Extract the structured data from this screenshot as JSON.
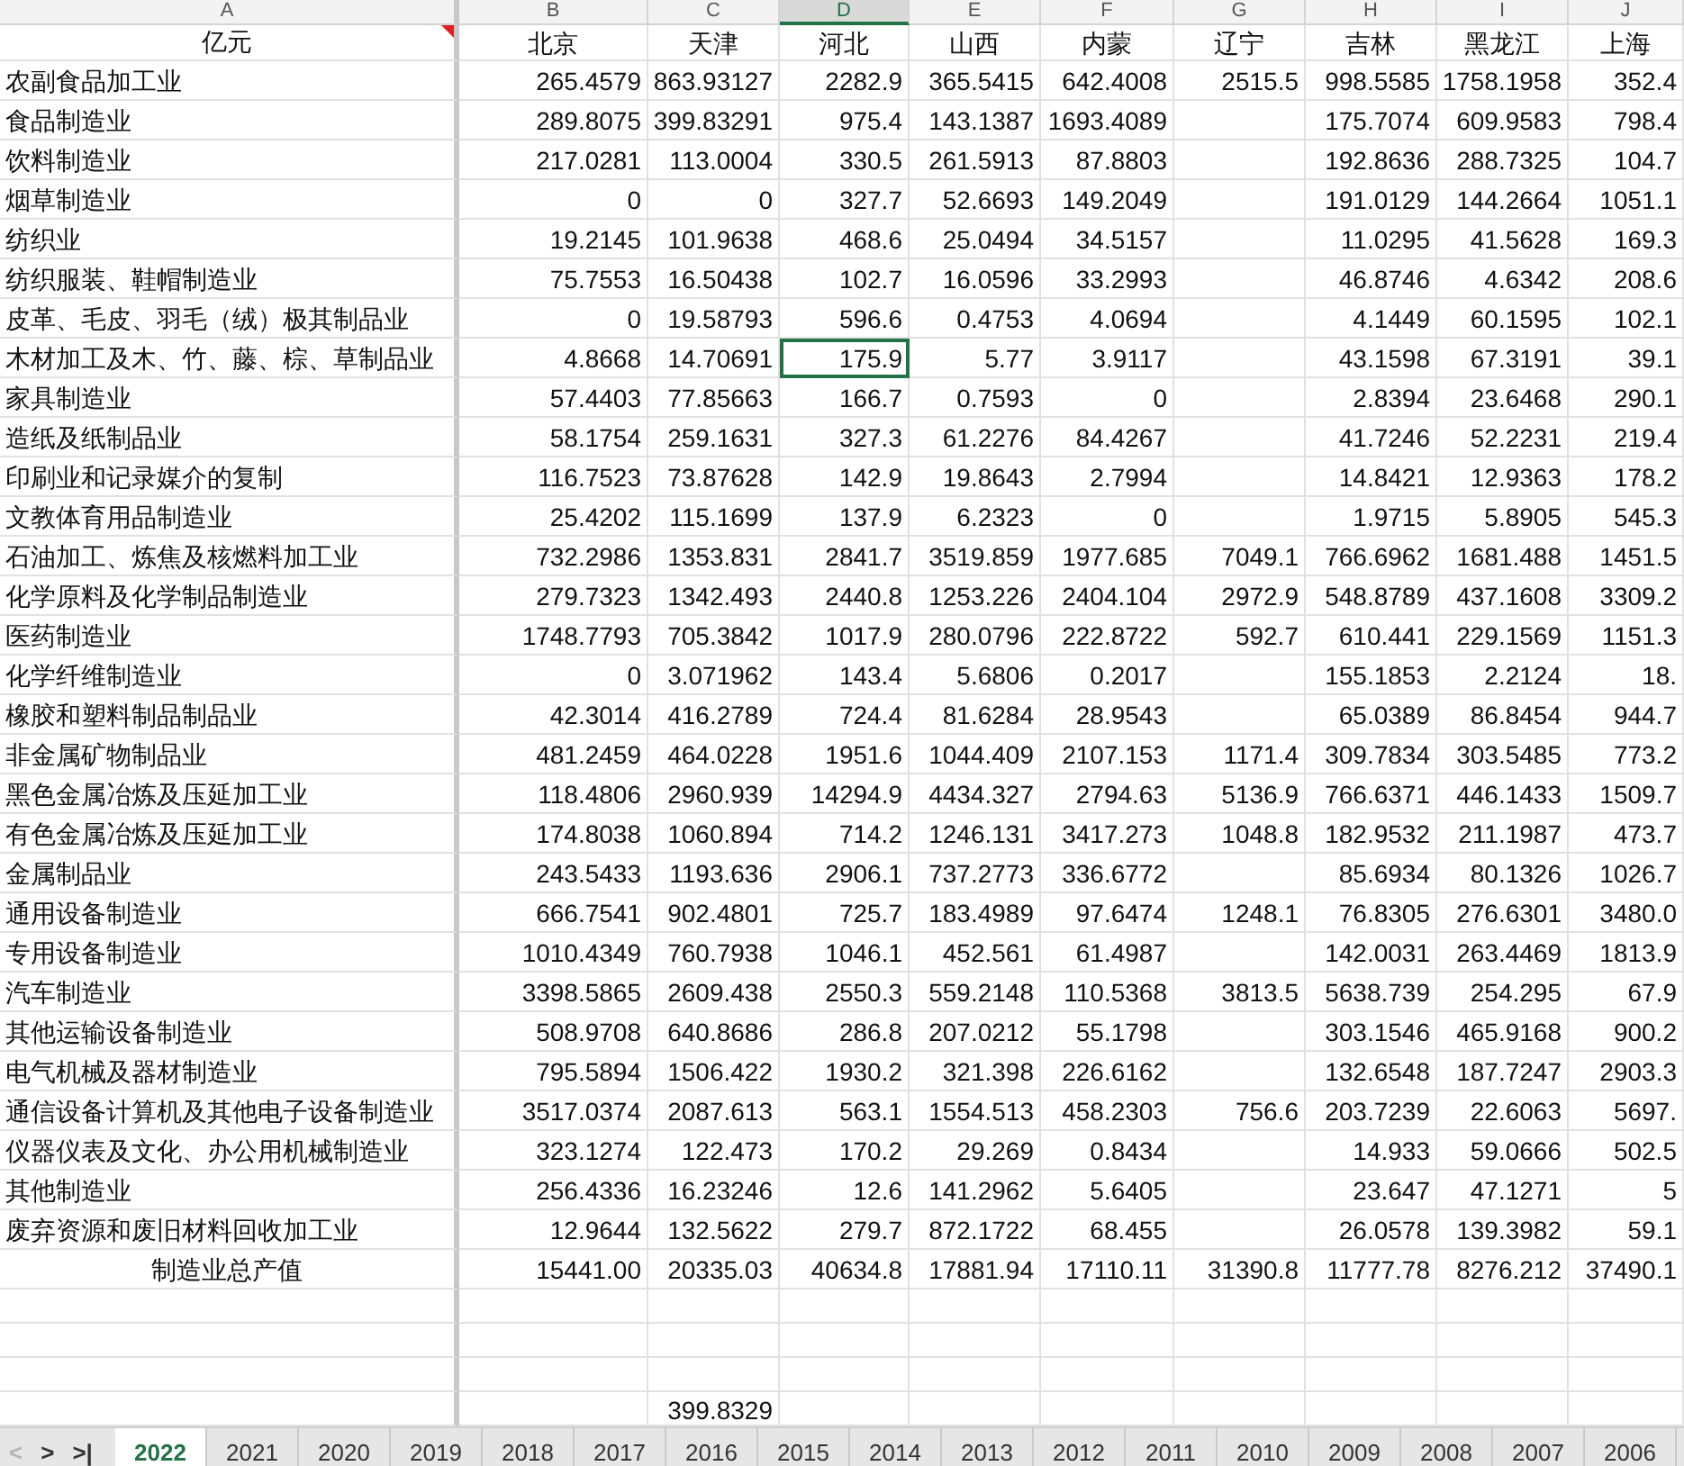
{
  "columns": [
    {
      "letter": "A",
      "selected": false
    },
    {
      "letter": "B",
      "selected": false
    },
    {
      "letter": "C",
      "selected": false
    },
    {
      "letter": "D",
      "selected": true
    },
    {
      "letter": "E",
      "selected": false
    },
    {
      "letter": "F",
      "selected": false
    },
    {
      "letter": "G",
      "selected": false
    },
    {
      "letter": "H",
      "selected": false
    },
    {
      "letter": "I",
      "selected": false
    },
    {
      "letter": "J",
      "selected": false
    }
  ],
  "rows": [
    {
      "kind": "header",
      "label": "亿元",
      "comment": true,
      "selected": false,
      "cells": [
        "北京",
        "天津",
        "河北",
        "山西",
        "内蒙",
        "辽宁",
        "吉林",
        "黑龙江",
        "上海"
      ]
    },
    {
      "kind": "data",
      "label": "农副食品加工业",
      "comment": false,
      "selected": false,
      "cells": [
        "265.4579",
        "863.93127",
        "2282.9",
        "365.5415",
        "642.4008",
        "2515.5",
        "998.5585",
        "1758.1958",
        "352.4"
      ]
    },
    {
      "kind": "data",
      "label": "食品制造业",
      "comment": false,
      "selected": false,
      "cells": [
        "289.8075",
        "399.83291",
        "975.4",
        "143.1387",
        "1693.4089",
        null,
        "175.7074",
        "609.9583",
        "798.4"
      ]
    },
    {
      "kind": "data",
      "label": "饮料制造业",
      "comment": false,
      "selected": false,
      "cells": [
        "217.0281",
        "113.0004",
        "330.5",
        "261.5913",
        "87.8803",
        null,
        "192.8636",
        "288.7325",
        "104.7"
      ]
    },
    {
      "kind": "data",
      "label": "烟草制造业",
      "comment": false,
      "selected": false,
      "cells": [
        "0",
        "0",
        "327.7",
        "52.6693",
        "149.2049",
        null,
        "191.0129",
        "144.2664",
        "1051.1"
      ]
    },
    {
      "kind": "data",
      "label": "纺织业",
      "comment": false,
      "selected": false,
      "cells": [
        "19.2145",
        "101.9638",
        "468.6",
        "25.0494",
        "34.5157",
        null,
        "11.0295",
        "41.5628",
        "169.3"
      ]
    },
    {
      "kind": "data",
      "label": "纺织服装、鞋帽制造业",
      "comment": false,
      "selected": false,
      "cells": [
        "75.7553",
        "16.50438",
        "102.7",
        "16.0596",
        "33.2993",
        null,
        "46.8746",
        "4.6342",
        "208.6"
      ]
    },
    {
      "kind": "data",
      "label": "皮革、毛皮、羽毛（绒）极其制品业",
      "comment": false,
      "selected": false,
      "cells": [
        "0",
        "19.58793",
        "596.6",
        "0.4753",
        "4.0694",
        null,
        "4.1449",
        "60.1595",
        "102.1"
      ]
    },
    {
      "kind": "data",
      "label": "木材加工及木、竹、藤、棕、草制品业",
      "comment": false,
      "selected": true,
      "cells": [
        "4.8668",
        "14.70691",
        "175.9",
        "5.77",
        "3.9117",
        null,
        "43.1598",
        "67.3191",
        "39.1"
      ]
    },
    {
      "kind": "data",
      "label": "家具制造业",
      "comment": false,
      "selected": false,
      "cells": [
        "57.4403",
        "77.85663",
        "166.7",
        "0.7593",
        "0",
        null,
        "2.8394",
        "23.6468",
        "290.1"
      ]
    },
    {
      "kind": "data",
      "label": "造纸及纸制品业",
      "comment": false,
      "selected": false,
      "cells": [
        "58.1754",
        "259.1631",
        "327.3",
        "61.2276",
        "84.4267",
        null,
        "41.7246",
        "52.2231",
        "219.4"
      ]
    },
    {
      "kind": "data",
      "label": "印刷业和记录媒介的复制",
      "comment": false,
      "selected": false,
      "cells": [
        "116.7523",
        "73.87628",
        "142.9",
        "19.8643",
        "2.7994",
        null,
        "14.8421",
        "12.9363",
        "178.2"
      ]
    },
    {
      "kind": "data",
      "label": "文教体育用品制造业",
      "comment": false,
      "selected": false,
      "cells": [
        "25.4202",
        "115.1699",
        "137.9",
        "6.2323",
        "0",
        null,
        "1.9715",
        "5.8905",
        "545.3"
      ]
    },
    {
      "kind": "data",
      "label": "石油加工、炼焦及核燃料加工业",
      "comment": false,
      "selected": false,
      "cells": [
        "732.2986",
        "1353.831",
        "2841.7",
        "3519.859",
        "1977.685",
        "7049.1",
        "766.6962",
        "1681.488",
        "1451.5"
      ]
    },
    {
      "kind": "data",
      "label": "化学原料及化学制品制造业",
      "comment": false,
      "selected": false,
      "cells": [
        "279.7323",
        "1342.493",
        "2440.8",
        "1253.226",
        "2404.104",
        "2972.9",
        "548.8789",
        "437.1608",
        "3309.2"
      ]
    },
    {
      "kind": "data",
      "label": "医药制造业",
      "comment": false,
      "selected": false,
      "cells": [
        "1748.7793",
        "705.3842",
        "1017.9",
        "280.0796",
        "222.8722",
        "592.7",
        "610.441",
        "229.1569",
        "1151.3"
      ]
    },
    {
      "kind": "data",
      "label": "化学纤维制造业",
      "comment": false,
      "selected": false,
      "cells": [
        "0",
        "3.071962",
        "143.4",
        "5.6806",
        "0.2017",
        null,
        "155.1853",
        "2.2124",
        "18."
      ]
    },
    {
      "kind": "data",
      "label": "橡胶和塑料制品制品业",
      "comment": false,
      "selected": false,
      "cells": [
        "42.3014",
        "416.2789",
        "724.4",
        "81.6284",
        "28.9543",
        null,
        "65.0389",
        "86.8454",
        "944.7"
      ]
    },
    {
      "kind": "data",
      "label": "非金属矿物制品业",
      "comment": false,
      "selected": false,
      "cells": [
        "481.2459",
        "464.0228",
        "1951.6",
        "1044.409",
        "2107.153",
        "1171.4",
        "309.7834",
        "303.5485",
        "773.2"
      ]
    },
    {
      "kind": "data",
      "label": "黑色金属冶炼及压延加工业",
      "comment": false,
      "selected": false,
      "cells": [
        "118.4806",
        "2960.939",
        "14294.9",
        "4434.327",
        "2794.63",
        "5136.9",
        "766.6371",
        "446.1433",
        "1509.7"
      ]
    },
    {
      "kind": "data",
      "label": "有色金属冶炼及压延加工业",
      "comment": false,
      "selected": false,
      "cells": [
        "174.8038",
        "1060.894",
        "714.2",
        "1246.131",
        "3417.273",
        "1048.8",
        "182.9532",
        "211.1987",
        "473.7"
      ]
    },
    {
      "kind": "data",
      "label": "金属制品业",
      "comment": false,
      "selected": false,
      "cells": [
        "243.5433",
        "1193.636",
        "2906.1",
        "737.2773",
        "336.6772",
        null,
        "85.6934",
        "80.1326",
        "1026.7"
      ]
    },
    {
      "kind": "data",
      "label": "通用设备制造业",
      "comment": false,
      "selected": false,
      "cells": [
        "666.7541",
        "902.4801",
        "725.7",
        "183.4989",
        "97.6474",
        "1248.1",
        "76.8305",
        "276.6301",
        "3480.0"
      ]
    },
    {
      "kind": "data",
      "label": "专用设备制造业",
      "comment": false,
      "selected": false,
      "cells": [
        "1010.4349",
        "760.7938",
        "1046.1",
        "452.561",
        "61.4987",
        null,
        "142.0031",
        "263.4469",
        "1813.9"
      ]
    },
    {
      "kind": "data",
      "label": "汽车制造业",
      "comment": false,
      "selected": false,
      "cells": [
        "3398.5865",
        "2609.438",
        "2550.3",
        "559.2148",
        "110.5368",
        "3813.5",
        "5638.739",
        "254.295",
        "67.9"
      ]
    },
    {
      "kind": "data",
      "label": "其他运输设备制造业",
      "comment": false,
      "selected": false,
      "cells": [
        "508.9708",
        "640.8686",
        "286.8",
        "207.0212",
        "55.1798",
        null,
        "303.1546",
        "465.9168",
        "900.2"
      ]
    },
    {
      "kind": "data",
      "label": "电气机械及器材制造业",
      "comment": false,
      "selected": false,
      "cells": [
        "795.5894",
        "1506.422",
        "1930.2",
        "321.398",
        "226.6162",
        null,
        "132.6548",
        "187.7247",
        "2903.3"
      ]
    },
    {
      "kind": "data",
      "label": "通信设备计算机及其他电子设备制造业",
      "comment": false,
      "selected": false,
      "cells": [
        "3517.0374",
        "2087.613",
        "563.1",
        "1554.513",
        "458.2303",
        "756.6",
        "203.7239",
        "22.6063",
        "5697."
      ]
    },
    {
      "kind": "data",
      "label": "仪器仪表及文化、办公用机械制造业",
      "comment": false,
      "selected": false,
      "cells": [
        "323.1274",
        "122.473",
        "170.2",
        "29.269",
        "0.8434",
        null,
        "14.933",
        "59.0666",
        "502.5"
      ]
    },
    {
      "kind": "data",
      "label": "其他制造业",
      "comment": false,
      "selected": false,
      "cells": [
        "256.4336",
        "16.23246",
        "12.6",
        "141.2962",
        "5.6405",
        null,
        "23.647",
        "47.1271",
        "5"
      ]
    },
    {
      "kind": "data",
      "label": "废弃资源和废旧材料回收加工业",
      "comment": false,
      "selected": false,
      "cells": [
        "12.9644",
        "132.5622",
        "279.7",
        "872.1722",
        "68.455",
        null,
        "26.0578",
        "139.3982",
        "59.1"
      ]
    },
    {
      "kind": "total",
      "label": "制造业总产值",
      "comment": false,
      "selected": false,
      "cells": [
        "15441.00",
        "20335.03",
        "40634.8",
        "17881.94",
        "17110.11",
        "31390.8",
        "11777.78",
        "8276.212",
        "37490.1"
      ]
    }
  ],
  "lower_rows": [
    {
      "kind": "data",
      "label": null,
      "comment": false,
      "selected": false,
      "cells": [
        null,
        "399.8329",
        null,
        null,
        null,
        null,
        null,
        null,
        null
      ]
    }
  ],
  "sheet_nav": [
    {
      "glyph": "<",
      "disabled": true
    },
    {
      "glyph": ">",
      "disabled": false
    },
    {
      "glyph": ">|",
      "disabled": false
    }
  ],
  "sheet_tabs": [
    {
      "label": "2022",
      "selected": true
    },
    {
      "label": "2021",
      "selected": false
    },
    {
      "label": "2020",
      "selected": false
    },
    {
      "label": "2019",
      "selected": false
    },
    {
      "label": "2018",
      "selected": false
    },
    {
      "label": "2017",
      "selected": false
    },
    {
      "label": "2016",
      "selected": false
    },
    {
      "label": "2015",
      "selected": false
    },
    {
      "label": "2014",
      "selected": false
    },
    {
      "label": "2013",
      "selected": false
    },
    {
      "label": "2012",
      "selected": false
    },
    {
      "label": "2011",
      "selected": false
    },
    {
      "label": "2010",
      "selected": false
    },
    {
      "label": "2009",
      "selected": false
    },
    {
      "label": "2008",
      "selected": false
    },
    {
      "label": "2007",
      "selected": false
    },
    {
      "label": "2006",
      "selected": false
    }
  ]
}
